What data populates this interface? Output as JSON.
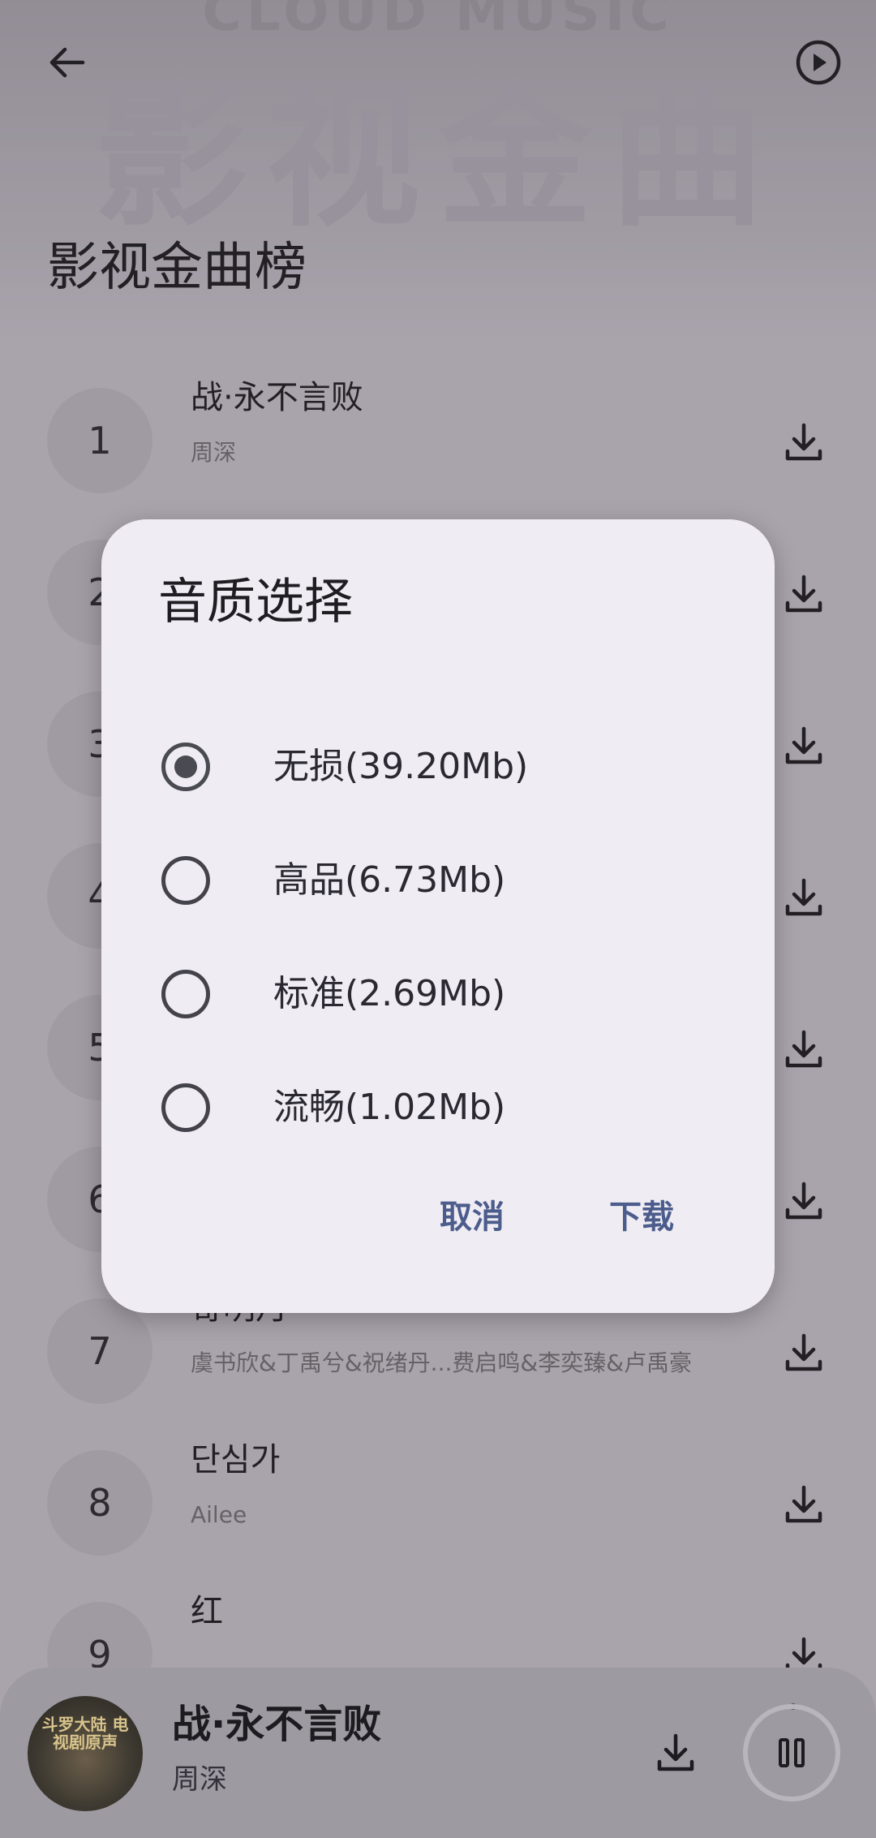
{
  "banner": {
    "logo_text": "CLOUD MUSIC",
    "big_text": "影视金曲"
  },
  "page": {
    "title": "影视金曲榜"
  },
  "icons": {
    "back": "arrow-left-icon",
    "play_all": "play-circle-icon",
    "download": "download-icon",
    "pause": "pause-icon"
  },
  "songs": [
    {
      "rank": "1",
      "title": "战·永不言败",
      "artist": "周深"
    },
    {
      "rank": "2",
      "title": "",
      "artist": ""
    },
    {
      "rank": "3",
      "title": "",
      "artist": ""
    },
    {
      "rank": "4",
      "title": "",
      "artist": ""
    },
    {
      "rank": "5",
      "title": "",
      "artist": ""
    },
    {
      "rank": "6",
      "title": "",
      "artist": ""
    },
    {
      "rank": "7",
      "title": "寄明月",
      "artist": "虞书欣&丁禹兮&祝绪丹...费启鸣&李奕臻&卢禹豪"
    },
    {
      "rank": "8",
      "title": "단심가",
      "artist": "Ailee"
    },
    {
      "rank": "9",
      "title": "红",
      "artist": ""
    }
  ],
  "dialog": {
    "title": "音质选择",
    "options": [
      {
        "label": "无损(39.20Mb)",
        "selected": true
      },
      {
        "label": "高品(6.73Mb)",
        "selected": false
      },
      {
        "label": "标准(2.69Mb)",
        "selected": false
      },
      {
        "label": "流畅(1.02Mb)",
        "selected": false
      }
    ],
    "cancel_label": "取消",
    "confirm_label": "下载"
  },
  "player": {
    "title": "战·永不言败",
    "artist": "周深",
    "cover_text": "斗罗大陆 电视剧原声"
  },
  "colors": {
    "dialog_bg": "#efedf3",
    "accent_button": "#4c5c8c",
    "player_bg": "#9e9aa2"
  }
}
